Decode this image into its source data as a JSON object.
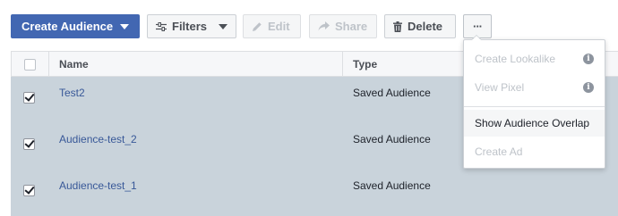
{
  "toolbar": {
    "create_audience_label": "Create Audience",
    "filters_label": "Filters",
    "edit_label": "Edit",
    "share_label": "Share",
    "delete_label": "Delete",
    "more_label": "···"
  },
  "table": {
    "columns": [
      "Name",
      "Type"
    ],
    "rows": [
      {
        "name": "Test2",
        "type": "Saved Audience",
        "checked": true
      },
      {
        "name": "Audience-test_2",
        "type": "Saved Audience",
        "checked": true
      },
      {
        "name": "Audience-test_1",
        "type": "Saved Audience",
        "checked": true
      }
    ]
  },
  "menu": {
    "items": [
      {
        "label": "Create Lookalike",
        "enabled": false,
        "icon": "info-icon"
      },
      {
        "label": "View Pixel",
        "enabled": false,
        "icon": "info-icon"
      },
      {
        "label": "Show Audience Overlap",
        "enabled": true,
        "highlighted": true
      },
      {
        "label": "Create Ad",
        "enabled": false
      }
    ]
  },
  "colors": {
    "primary": "#4267b2",
    "selected_row": "#c9d3db",
    "link": "#385898",
    "disabled_text": "#bec3c9"
  }
}
